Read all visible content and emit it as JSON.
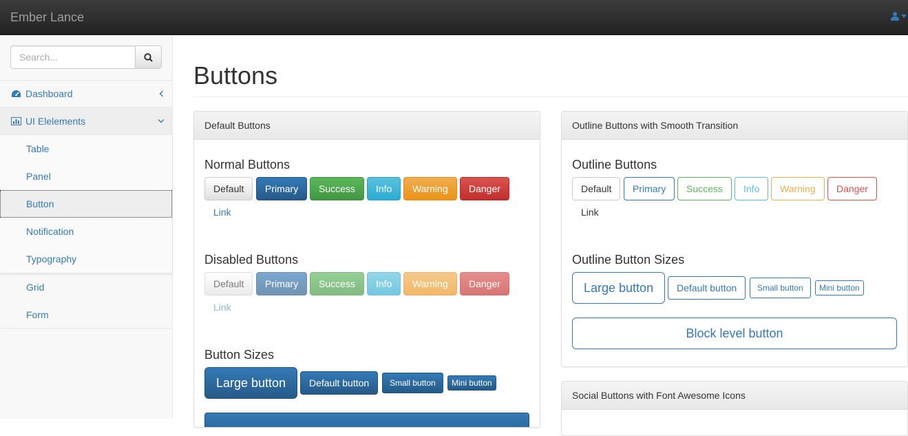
{
  "navbar": {
    "brand": "Ember Lance",
    "user_icon": "user-icon"
  },
  "sidebar": {
    "search": {
      "placeholder": "Search..."
    },
    "items": [
      {
        "label": "Dashboard",
        "icon": "dashboard-icon"
      },
      {
        "label": "UI Elelements",
        "icon": "bar-chart-icon"
      }
    ],
    "subitems": [
      "Table",
      "Panel",
      "Button",
      "Notification",
      "Typography"
    ],
    "bottom_items": [
      "Grid",
      "Form"
    ]
  },
  "page": {
    "title": "Buttons"
  },
  "default_panel": {
    "heading": "Default Buttons",
    "normal_title": "Normal Buttons",
    "disabled_title": "Disabled Buttons",
    "sizes_title": "Button Sizes",
    "buttons": {
      "default": "Default",
      "primary": "Primary",
      "success": "Success",
      "info": "Info",
      "warning": "Warning",
      "danger": "Danger",
      "link": "Link"
    },
    "sizes": {
      "large": "Large button",
      "default": "Default button",
      "small": "Small button",
      "mini": "Mini button"
    }
  },
  "outline_panel": {
    "heading": "Outline Buttons with Smooth Transition",
    "outline_title": "Outline Buttons",
    "sizes_title": "Outline Button Sizes",
    "buttons": {
      "default": "Default",
      "primary": "Primary",
      "success": "Success",
      "info": "Info",
      "warning": "Warning",
      "danger": "Danger",
      "link": "Link"
    },
    "sizes": {
      "large": "Large button",
      "default": "Default button",
      "small": "Small button",
      "mini": "Mini button"
    },
    "block": "Block level button"
  },
  "social_panel": {
    "heading": "Social Buttons with Font Awesome Icons"
  },
  "colors": {
    "primary": "#337ab7",
    "success": "#5cb85c",
    "info": "#5bc0de",
    "warning": "#f0ad4e",
    "danger": "#d9534f",
    "navbar": "#222222"
  }
}
